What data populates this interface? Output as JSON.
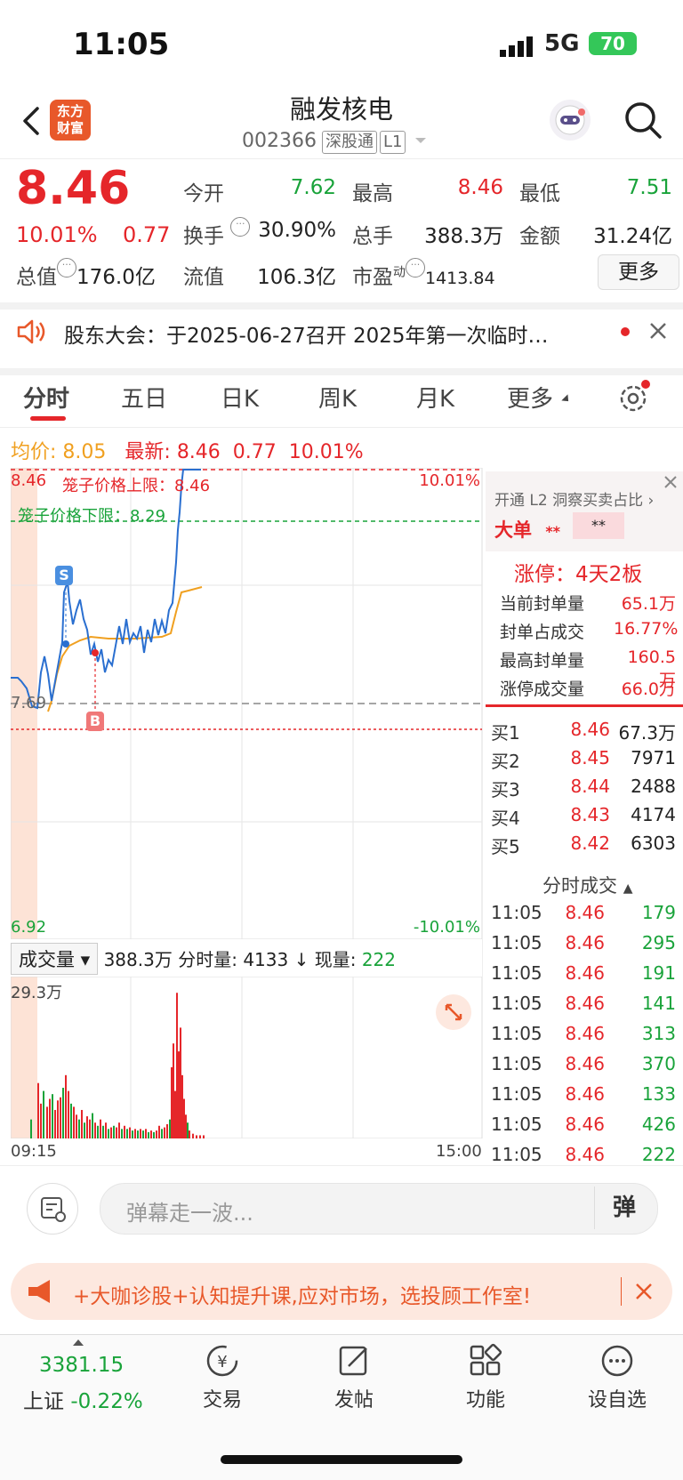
{
  "status": {
    "time": "11:05",
    "network": "5G",
    "battery": "70"
  },
  "header": {
    "logo_line1": "东方",
    "logo_line2": "财富",
    "name": "融发核电",
    "code": "002366",
    "tag1": "深股通",
    "tag2": "L1"
  },
  "quote": {
    "price": "8.46",
    "change_pct": "10.01%",
    "change_val": "0.77",
    "open_label": "今开",
    "open": "7.62",
    "high_label": "最高",
    "high": "8.46",
    "low_label": "最低",
    "low": "7.51",
    "turnover_label": "换手",
    "turnover": "30.90%",
    "volume_label": "总手",
    "volume": "388.3万",
    "amount_label": "金额",
    "amount": "31.24亿",
    "mktcap_label": "总值",
    "mktcap": "176.0亿",
    "float_label": "流值",
    "float": "106.3亿",
    "pe_label": "市盈",
    "pe_sup": "动",
    "pe": "1413.84",
    "more": "更多"
  },
  "notice": {
    "text": "股东大会：于2025-06-27召开 2025年第一次临时…"
  },
  "tabs": [
    "分时",
    "五日",
    "日K",
    "周K",
    "月K",
    "更多"
  ],
  "chart": {
    "avg_label": "均价:",
    "avg": "8.05",
    "latest_label": "最新:",
    "latest": "8.46",
    "latest_chg": "0.77",
    "latest_pct": "10.01%",
    "top_price": "8.46",
    "top_pct": "10.01%",
    "bottom_price": "6.92",
    "bottom_pct": "-10.01%",
    "mid_price": "7.69",
    "cage_up": "笼子价格上限：8.46",
    "cage_down": "笼子价格下限：8.29",
    "marker_s": "S",
    "marker_b": "B",
    "time_start": "09:15",
    "time_end": "15:00"
  },
  "side": {
    "l2_text": "开通 L2 洞察买卖占比",
    "big_order": "大单",
    "stars1": "**",
    "stars2": "**",
    "limit_title": "涨停：4天2板",
    "rows": [
      {
        "label": "当前封单量",
        "value": "65.1万"
      },
      {
        "label": "封单占成交",
        "value": "16.77%"
      },
      {
        "label": "最高封单量",
        "value": "160.5万"
      },
      {
        "label": "涨停成交量",
        "value": "66.0万"
      }
    ],
    "bids": [
      {
        "label": "买1",
        "price": "8.46",
        "vol": "67.3万"
      },
      {
        "label": "买2",
        "price": "8.45",
        "vol": "7971"
      },
      {
        "label": "买3",
        "price": "8.44",
        "vol": "2488"
      },
      {
        "label": "买4",
        "price": "8.43",
        "vol": "4174"
      },
      {
        "label": "买5",
        "price": "8.42",
        "vol": "6303"
      }
    ],
    "ticks_title": "分时成交",
    "ticks": [
      {
        "time": "11:05",
        "price": "8.46",
        "vol": "179"
      },
      {
        "time": "11:05",
        "price": "8.46",
        "vol": "295"
      },
      {
        "time": "11:05",
        "price": "8.46",
        "vol": "191"
      },
      {
        "time": "11:05",
        "price": "8.46",
        "vol": "141"
      },
      {
        "time": "11:05",
        "price": "8.46",
        "vol": "313"
      },
      {
        "time": "11:05",
        "price": "8.46",
        "vol": "370"
      },
      {
        "time": "11:05",
        "price": "8.46",
        "vol": "133"
      },
      {
        "time": "11:05",
        "price": "8.46",
        "vol": "426"
      },
      {
        "time": "11:05",
        "price": "8.46",
        "vol": "222"
      }
    ]
  },
  "volume": {
    "selector": "成交量",
    "total": "388.3万",
    "period_label": "分时量:",
    "period": "4133",
    "now_label": "现量:",
    "now": "222",
    "max": "29.3万"
  },
  "barrage": {
    "placeholder": "弹幕走一波...",
    "btn": "弹"
  },
  "ad": {
    "text": "+大咖诊股+认知提升课,应对市场，选投顾工作室!"
  },
  "nav": {
    "index_value": "3381.15",
    "index_name": "上证",
    "index_chg": "-0.22%",
    "trade": "交易",
    "post": "发帖",
    "func": "功能",
    "watch": "设自选"
  },
  "colors": {
    "up": "#e5262a",
    "down": "#19a33a",
    "avg": "#f0a020",
    "price_line": "#2a6fd0"
  }
}
